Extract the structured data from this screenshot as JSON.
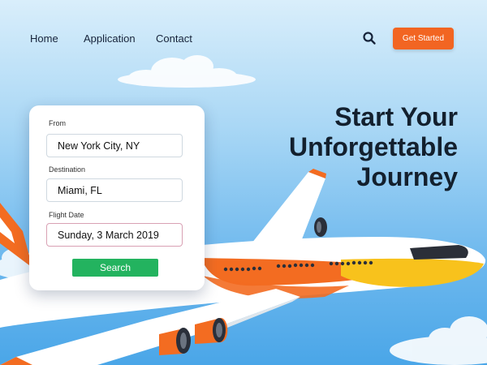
{
  "nav": {
    "links": [
      "Home",
      "Application",
      "Contact"
    ],
    "search_icon": "search-icon",
    "cta_label": "Get Started"
  },
  "hero": {
    "title_lines": [
      "Start Your",
      "Unforgettable",
      "Journey"
    ]
  },
  "form": {
    "from_label": "From",
    "from_value": "New York City, NY",
    "destination_label": "Destination",
    "destination_value": "Miami, FL",
    "date_label": "Flight Date",
    "date_value": "Sunday, 3 March 2019",
    "search_label": "Search"
  },
  "colors": {
    "accent": "#f26522",
    "search_button": "#23b35f",
    "heading": "#13202e",
    "plane_orange": "#f36c21",
    "plane_yellow": "#f8c21c"
  }
}
